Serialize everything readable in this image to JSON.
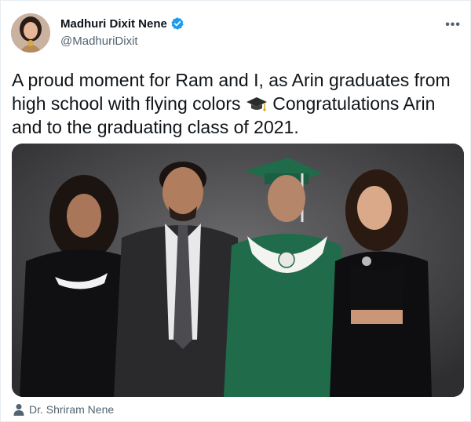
{
  "author": {
    "display_name": "Madhuri Dixit Nene",
    "handle": "@MadhuriDixit",
    "verified": true,
    "avatar_icon": "avatar-photo"
  },
  "more_icon": "more-horizontal-icon",
  "tweet": {
    "text_before_emoji": "A proud moment for Ram and I, as Arin graduates from high school with flying colors ",
    "emoji": "graduation-cap-icon",
    "text_after_emoji": " Congratulations Arin and to the graduating class of 2021."
  },
  "media": {
    "type": "photo"
  },
  "tagged_user": {
    "icon": "person-icon",
    "name": "Dr. Shriram Nene"
  },
  "colors": {
    "text": "#0f1419",
    "secondary": "#536471",
    "verified_blue": "#1d9bf0",
    "gown_green": "#1f6b4a"
  }
}
